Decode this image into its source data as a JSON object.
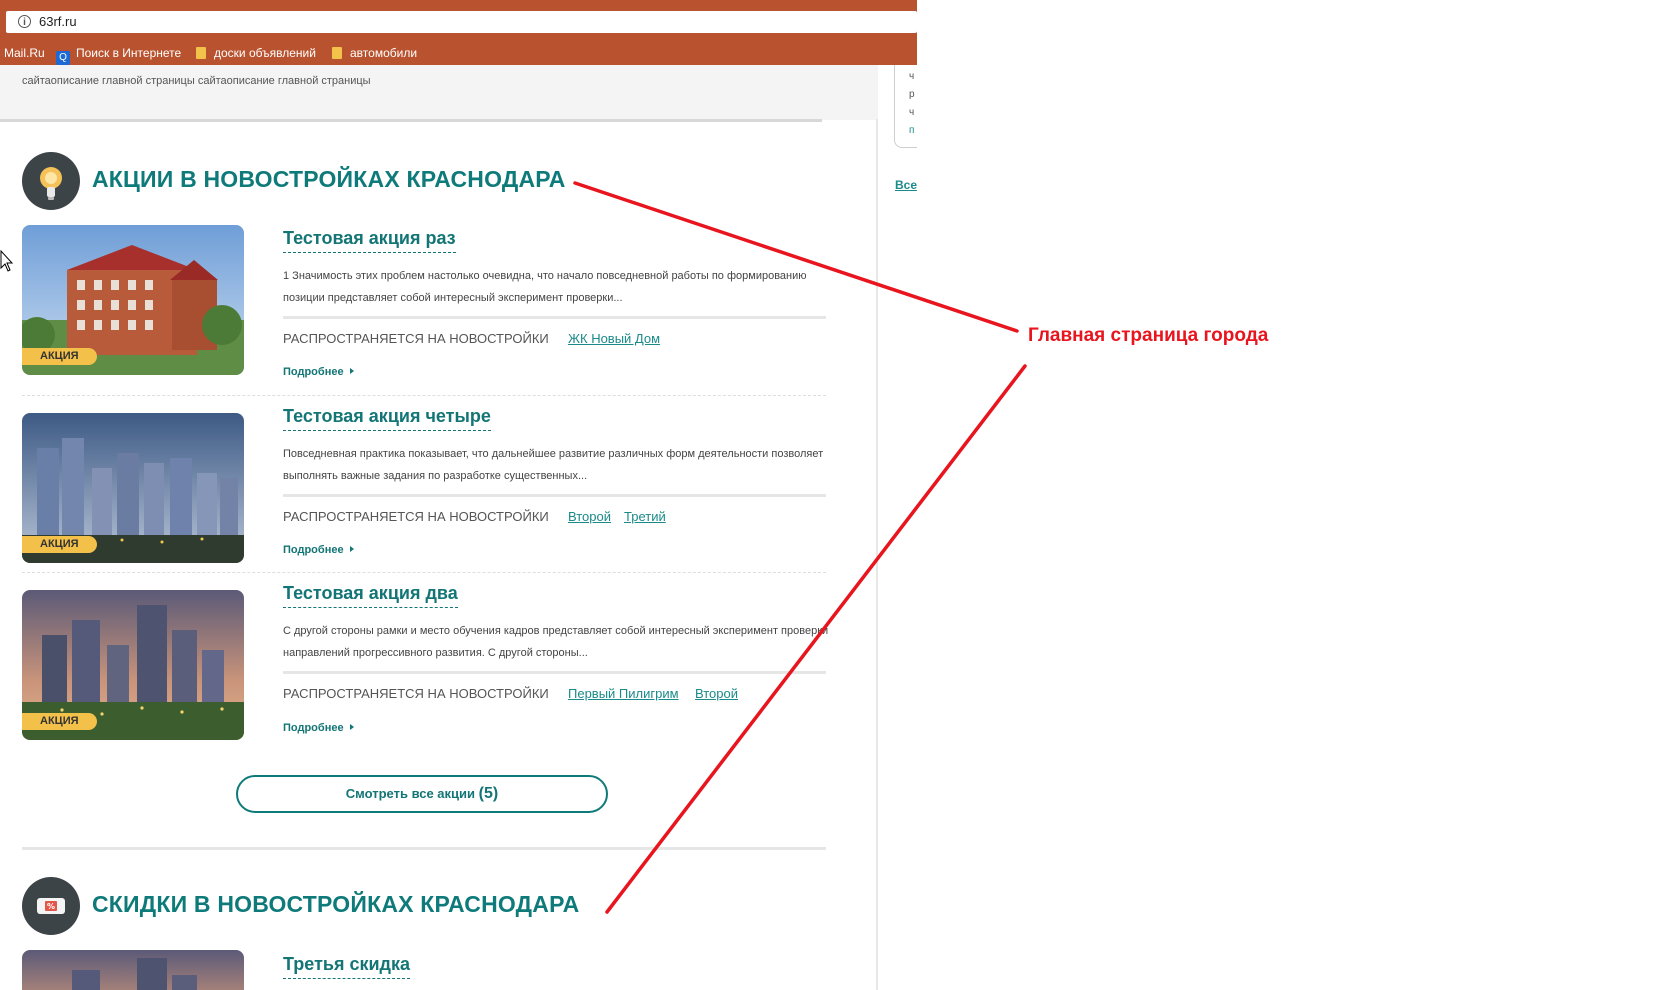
{
  "browser": {
    "url": "63rf.ru",
    "bookmarks": [
      {
        "label": "Mail.Ru",
        "icon": "mailru-icon"
      },
      {
        "label": "Поиск в Интернете",
        "icon": "search-icon"
      },
      {
        "label": "доски объявлений",
        "icon": "folder-icon"
      },
      {
        "label": "автомобили",
        "icon": "folder-icon"
      }
    ]
  },
  "page": {
    "description": "сайтаописание главной страницы сайтаописание главной страницы",
    "sidebar_letters": [
      "ч",
      "р",
      "ч",
      "п"
    ],
    "sidebar_all_link": "Все",
    "sections": [
      {
        "title": "АКЦИИ В НОВОСТРОЙКАХ КРАСНОДАРА",
        "icon": "lightbulb-icon",
        "items": [
          {
            "title": "Тестовая акция раз",
            "badge": "АКЦИЯ",
            "description": "1 Значимость этих проблем настолько очевидна, что начало повседневной работы по формированию позиции представляет собой интересный эксперимент проверки...",
            "applies_label": "РАСПРОСТРАНЯЕТСЯ НА НОВОСТРОЙКИ",
            "links": [
              "ЖК Новый Дом"
            ],
            "more": "Подробнее"
          },
          {
            "title": "Тестовая акция четыре",
            "badge": "АКЦИЯ",
            "description": "Повседневная практика показывает, что дальнейшее развитие различных форм деятельности позволяет выполнять важные задания по разработке существенных...",
            "applies_label": "РАСПРОСТРАНЯЕТСЯ НА НОВОСТРОЙКИ",
            "links": [
              "Второй",
              "Третий"
            ],
            "more": "Подробнее"
          },
          {
            "title": "Тестовая акция два",
            "badge": "АКЦИЯ",
            "description": "С другой стороны рамки и место обучения кадров представляет собой интересный эксперимент проверки направлений прогрессивного развития. С другой стороны...",
            "applies_label": "РАСПРОСТРАНЯЕТСЯ НА НОВОСТРОЙКИ",
            "links": [
              "Первый Пилигрим",
              "Второй"
            ],
            "more": "Подробнее"
          }
        ],
        "view_all_label": "Смотреть все акции",
        "view_all_count": "(5)"
      },
      {
        "title": "СКИДКИ В НОВОСТРОЙКАХ КРАСНОДАРА",
        "icon": "discount-ticket-icon",
        "items": [
          {
            "title": "Третья скидка"
          }
        ]
      }
    ]
  },
  "annotation": {
    "text": "Главная страница города",
    "color": "#e8141e"
  },
  "colors": {
    "browser_chrome": "#b9532f",
    "accent": "#0f7a7a",
    "badge": "#f3c04a"
  }
}
